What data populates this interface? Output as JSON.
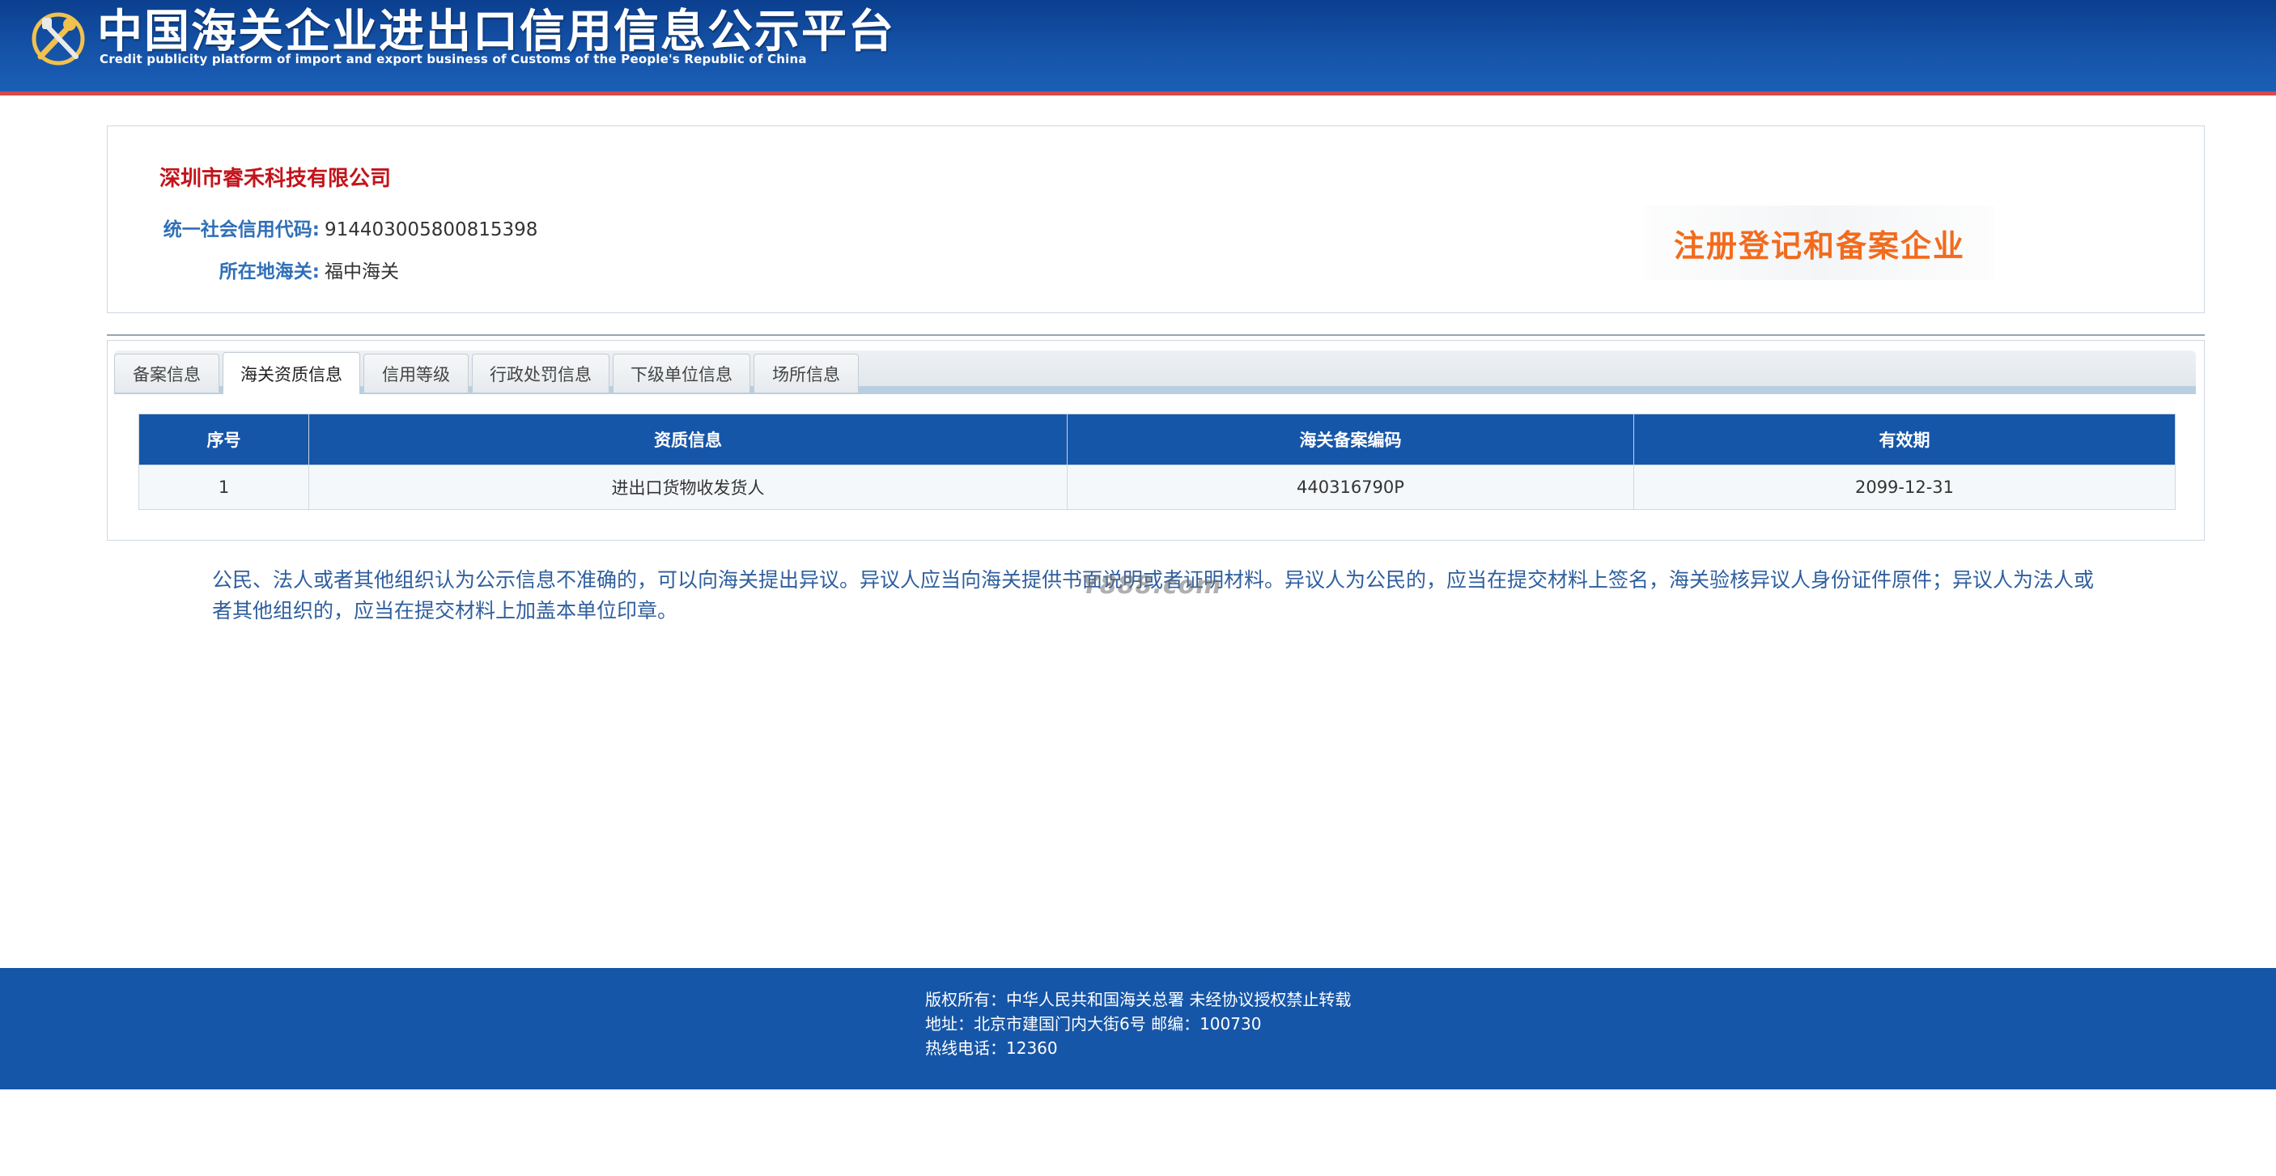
{
  "header": {
    "title": "中国海关企业进出口信用信息公示平台",
    "subtitle": "Credit publicity platform of import and export business of Customs of the People's Republic of China",
    "emblem_icon": "customs-emblem-icon"
  },
  "company": {
    "name": "深圳市睿禾科技有限公司",
    "credit_code_label": "统一社会信用代码:",
    "credit_code": "914403005800815398",
    "customs_label": "所在地海关:",
    "customs": "福中海关",
    "badge": "注册登记和备案企业"
  },
  "tabs": [
    {
      "label": "备案信息",
      "active": false
    },
    {
      "label": "海关资质信息",
      "active": true
    },
    {
      "label": "信用等级",
      "active": false
    },
    {
      "label": "行政处罚信息",
      "active": false
    },
    {
      "label": "下级单位信息",
      "active": false
    },
    {
      "label": "场所信息",
      "active": false
    }
  ],
  "table": {
    "headers": [
      "序号",
      "资质信息",
      "海关备案编码",
      "有效期"
    ],
    "rows": [
      [
        "1",
        "进出口货物收发货人",
        "440316790P",
        "2099-12-31"
      ]
    ]
  },
  "notice": "公民、法人或者其他组织认为公示信息不准确的，可以向海关提出异议。异议人应当向海关提供书面说明或者证明材料。异议人为公民的，应当在提交材料上签名，海关验核异议人身份证件原件；异议人为法人或者其他组织的，应当在提交材料上加盖本单位印章。",
  "watermark": "Y888.com",
  "footer": {
    "line1": "版权所有：中华人民共和国海关总署   未经协议授权禁止转载",
    "line2": "地址：北京市建国门内大街6号 邮编：100730",
    "line3": "热线电话：12360"
  },
  "colors": {
    "header_blue": "#1553a8",
    "accent_red": "#c3141b",
    "label_blue": "#2f6fb8",
    "badge_orange": "#f26b1d",
    "table_header": "#1656a8"
  }
}
